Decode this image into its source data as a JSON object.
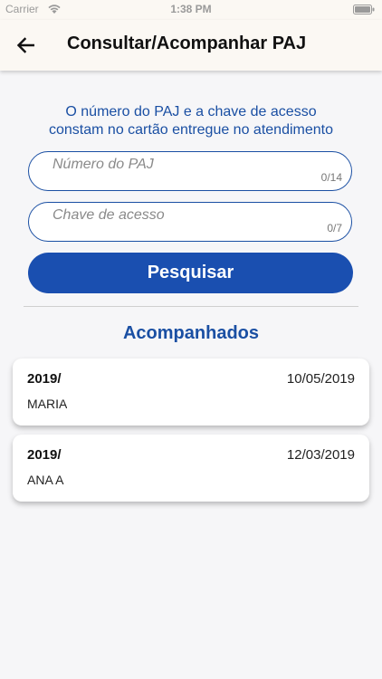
{
  "status_bar": {
    "carrier": "Carrier",
    "time": "1:38 PM"
  },
  "header": {
    "title": "Consultar/Acompanhar PAJ",
    "back_icon": "arrow-left-icon"
  },
  "info": {
    "line1": "O número do PAJ e a chave de acesso",
    "line2": "constam no cartão entregue no atendimento"
  },
  "form": {
    "paj": {
      "placeholder": "Número do PAJ",
      "value": "",
      "counter": "0/14"
    },
    "chave": {
      "placeholder": "Chave de acesso",
      "value": "",
      "counter": "0/7"
    },
    "search_label": "Pesquisar"
  },
  "section": {
    "title": "Acompanhados"
  },
  "cards": [
    {
      "code": "2019/",
      "date": "10/05/2019",
      "name": "MARIA"
    },
    {
      "code": "2019/",
      "date": "12/03/2019",
      "name": "ANA A"
    }
  ],
  "colors": {
    "accent": "#1a4fb0",
    "text_accent": "#1a4fa3",
    "header_bg": "#fbf8f3",
    "page_bg": "#f6f6f8"
  }
}
